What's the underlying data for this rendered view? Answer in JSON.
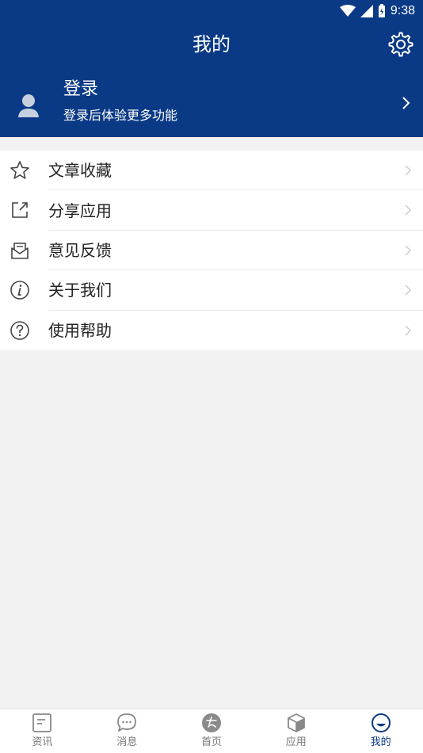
{
  "status_bar": {
    "time": "9:38"
  },
  "header": {
    "title": "我的"
  },
  "profile": {
    "name": "登录",
    "subtitle": "登录后体验更多功能"
  },
  "menu": {
    "items": [
      {
        "label": "文章收藏",
        "icon": "star-icon"
      },
      {
        "label": "分享应用",
        "icon": "share-icon"
      },
      {
        "label": "意见反馈",
        "icon": "feedback-icon"
      },
      {
        "label": "关于我们",
        "icon": "info-icon"
      },
      {
        "label": "使用帮助",
        "icon": "help-icon"
      }
    ]
  },
  "tabbar": {
    "tabs": [
      {
        "label": "资讯",
        "icon": "news-icon",
        "active": false
      },
      {
        "label": "消息",
        "icon": "message-icon",
        "active": false
      },
      {
        "label": "首页",
        "icon": "home-icon",
        "active": false
      },
      {
        "label": "应用",
        "icon": "apps-icon",
        "active": false
      },
      {
        "label": "我的",
        "icon": "mine-icon",
        "active": true
      }
    ]
  },
  "colors": {
    "primary": "#0a3a86",
    "background": "#f2f2f2"
  }
}
